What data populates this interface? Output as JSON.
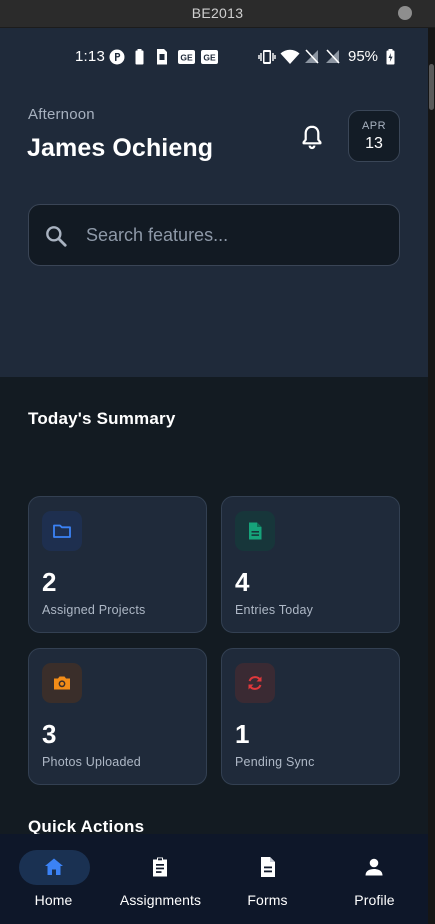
{
  "window": {
    "title": "BE2013"
  },
  "status_bar": {
    "time": "1:13",
    "battery_percent": "95%",
    "icons": [
      "p-badge-icon",
      "battery-saver-icon",
      "sim-icon",
      "ge-badge-icon",
      "ge-badge-icon",
      "vibrate-icon",
      "wifi-icon",
      "no-signal-icon",
      "no-signal-icon",
      "battery-icon"
    ]
  },
  "header": {
    "greeting": "Afternoon",
    "user_name": "James Ochieng",
    "date_month": "APR",
    "date_day": "13"
  },
  "search": {
    "placeholder": "Search features..."
  },
  "summary": {
    "title": "Today's Summary",
    "cards": [
      {
        "value": "2",
        "label": "Assigned Projects",
        "icon": "folder-icon",
        "accent": "#3b82f6",
        "icon_bg": "#1e2f4f"
      },
      {
        "value": "4",
        "label": "Entries Today",
        "icon": "document-icon",
        "accent": "#16a37a",
        "icon_bg": "#17363a"
      },
      {
        "value": "3",
        "label": "Photos Uploaded",
        "icon": "camera-icon",
        "accent": "#f28c18",
        "icon_bg": "#3a2e2a"
      },
      {
        "value": "1",
        "label": "Pending Sync",
        "icon": "sync-icon",
        "accent": "#e0383b",
        "icon_bg": "#3a2a33"
      }
    ]
  },
  "quick_actions": {
    "title": "Quick Actions"
  },
  "bottom_nav": {
    "active": "Home",
    "items": [
      {
        "label": "Home",
        "icon": "home-icon"
      },
      {
        "label": "Assignments",
        "icon": "clipboard-icon"
      },
      {
        "label": "Forms",
        "icon": "form-icon"
      },
      {
        "label": "Profile",
        "icon": "person-icon"
      }
    ]
  },
  "colors": {
    "header_bg": "#1f2a3a",
    "body_bg": "#131b22",
    "card_bg": "#1f2a3a",
    "nav_bg": "#0e1729",
    "active_accent": "#3b82f6"
  }
}
